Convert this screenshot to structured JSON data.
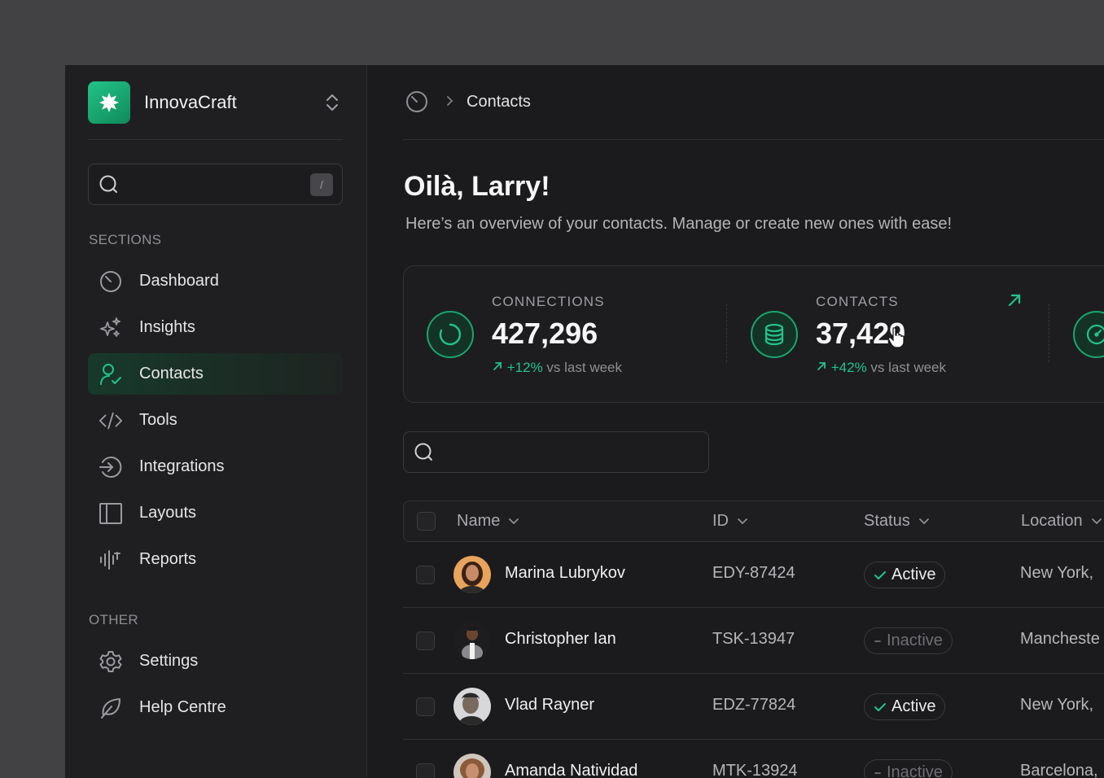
{
  "app": {
    "name": "InnovaCraft",
    "search_shortcut": "/"
  },
  "sidebar": {
    "sections_label": "SECTIONS",
    "sections": [
      {
        "label": "Dashboard",
        "icon": "dashboard-gauge-icon",
        "active": false
      },
      {
        "label": "Insights",
        "icon": "sparkles-icon",
        "active": false
      },
      {
        "label": "Contacts",
        "icon": "user-check-icon",
        "active": true
      },
      {
        "label": "Tools",
        "icon": "code-icon",
        "active": false
      },
      {
        "label": "Integrations",
        "icon": "arrow-circle-icon",
        "active": false
      },
      {
        "label": "Layouts",
        "icon": "sidebar-layout-icon",
        "active": false
      },
      {
        "label": "Reports",
        "icon": "audio-bars-icon",
        "active": false
      }
    ],
    "other_label": "OTHER",
    "other": [
      {
        "label": "Settings",
        "icon": "gear-icon"
      },
      {
        "label": "Help Centre",
        "icon": "leaf-icon"
      }
    ]
  },
  "breadcrumb": {
    "current": "Contacts"
  },
  "header": {
    "greeting": "Oilà, Larry!",
    "subtitle": "Here’s an overview of your contacts. Manage or create new ones with ease!"
  },
  "stats": [
    {
      "label": "CONNECTIONS",
      "value": "427,296",
      "delta": "+12%",
      "delta_text": "vs last week",
      "icon": "loader-ring-icon"
    },
    {
      "label": "CONTACTS",
      "value": "37,429",
      "delta": "+42%",
      "delta_text": "vs last week",
      "icon": "database-icon"
    }
  ],
  "table": {
    "columns": [
      "Name",
      "ID",
      "Status",
      "Location"
    ],
    "rows": [
      {
        "name": "Marina Lubrykov",
        "id": "EDY-87424",
        "status": "Active",
        "location": "New York,"
      },
      {
        "name": "Christopher Ian",
        "id": "TSK-13947",
        "status": "Inactive",
        "location": "Mancheste"
      },
      {
        "name": "Vlad Rayner",
        "id": "EDZ-77824",
        "status": "Active",
        "location": "New York,"
      },
      {
        "name": "Amanda Natividad",
        "id": "MTK-13924",
        "status": "Inactive",
        "location": "Barcelona,"
      }
    ]
  },
  "colors": {
    "accent": "#22c38a",
    "background": "#1b1b1d",
    "sidebar": "#1f1f21"
  }
}
